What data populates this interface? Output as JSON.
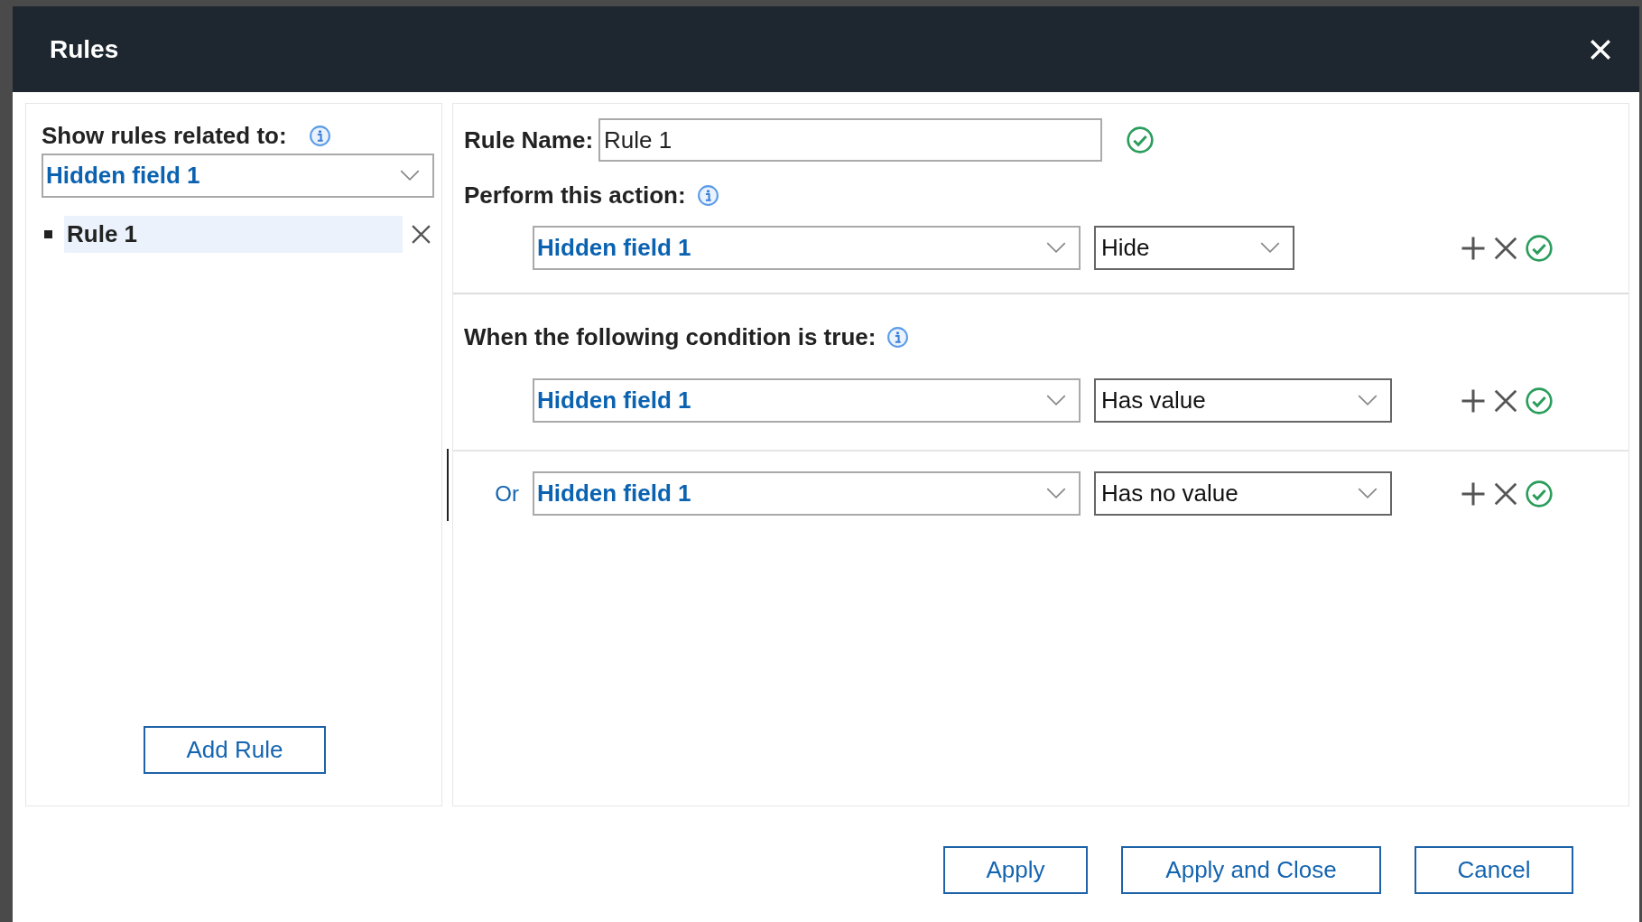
{
  "dialog": {
    "title": "Rules"
  },
  "sidebar": {
    "label": "Show rules related to:",
    "filter": {
      "value": "Hidden field 1"
    },
    "rules": [
      {
        "name": "Rule 1",
        "selected": true
      }
    ],
    "add_button": "Add Rule"
  },
  "editor": {
    "rule_name_label": "Rule Name:",
    "rule_name": "Rule 1",
    "action_label": "Perform this action:",
    "actions": [
      {
        "field": "Hidden field 1",
        "operation": "Hide"
      }
    ],
    "condition_label": "When the following condition is true:",
    "conditions": [
      {
        "field": "Hidden field 1",
        "operation": "Has value"
      },
      {
        "connector": "Or",
        "field": "Hidden field 1",
        "operation": "Has no value"
      }
    ]
  },
  "buttons": [
    "Apply",
    "Apply and Close",
    "Cancel"
  ]
}
